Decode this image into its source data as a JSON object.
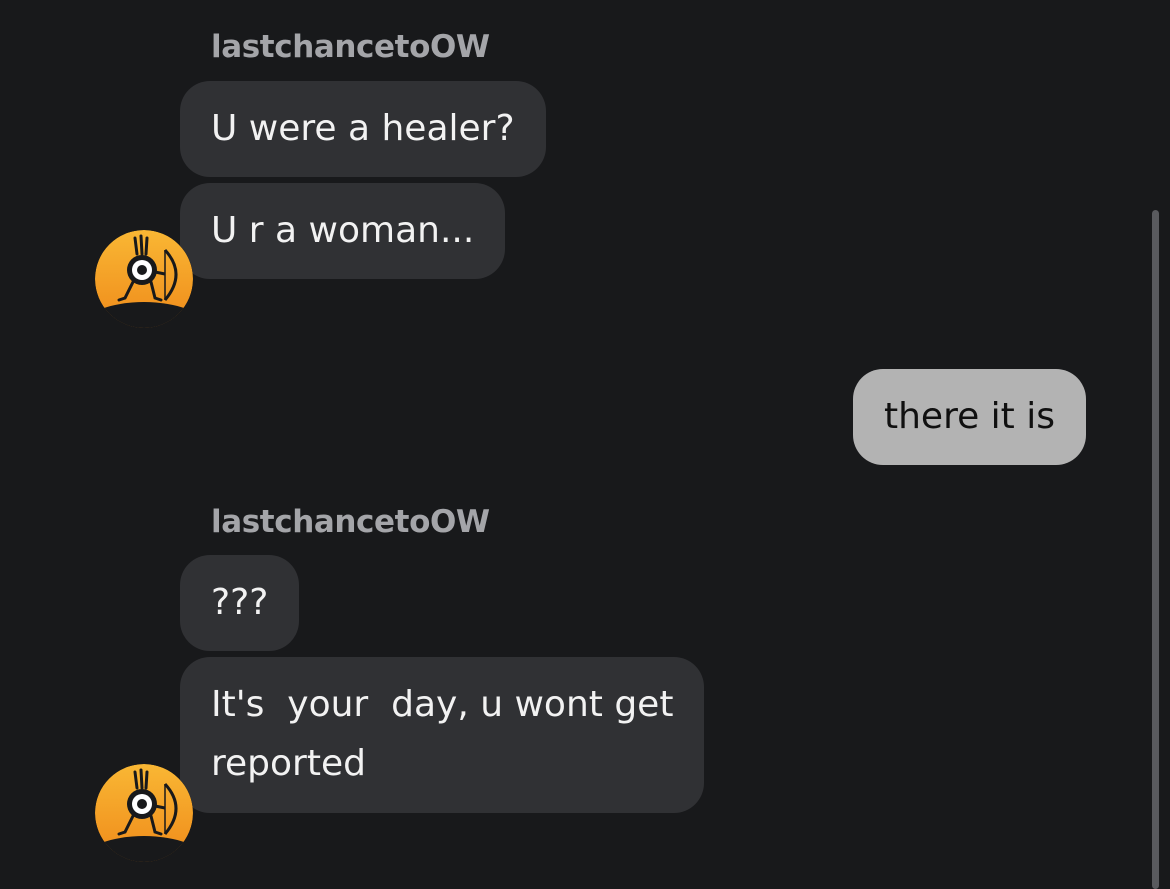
{
  "chat": {
    "messages": [
      {
        "sender": "lastchancetoOW",
        "bubbles": [
          "U were a healer?",
          "U r a woman..."
        ],
        "avatar_icon": "archer-cyclops-avatar-icon"
      },
      {
        "sender": "me",
        "bubbles": [
          "there it is"
        ]
      },
      {
        "sender": "lastchancetoOW",
        "bubbles": [
          "???",
          "It's  your  day, u wont get\nreported"
        ],
        "avatar_icon": "archer-cyclops-avatar-icon"
      }
    ]
  },
  "colors": {
    "background": "#18191b",
    "incoming_bubble": "#303134",
    "outgoing_bubble": "#b3b3b3",
    "sender_name": "#a4a5a9",
    "avatar_orange": "#f5a024"
  }
}
